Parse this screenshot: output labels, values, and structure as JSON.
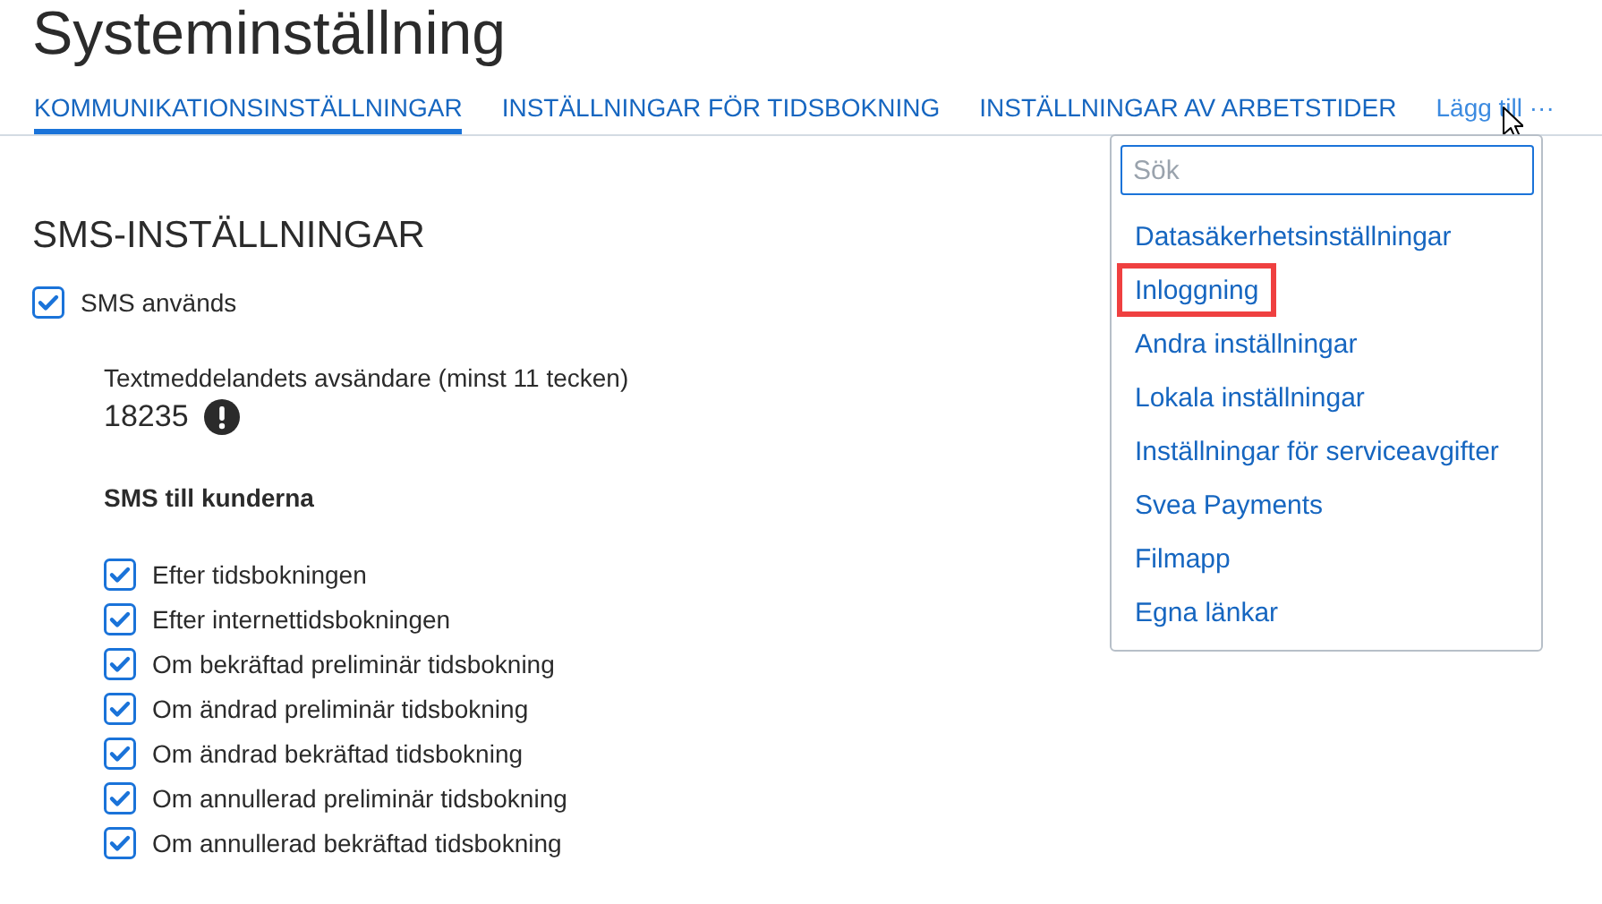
{
  "page": {
    "title": "Systeminställning"
  },
  "tabs": [
    {
      "label": "KOMMUNIKATIONSINSTÄLLNINGAR",
      "selected": true
    },
    {
      "label": "INSTÄLLNINGAR FÖR TIDSBOKNING",
      "selected": false
    },
    {
      "label": "INSTÄLLNINGAR AV ARBETSTIDER",
      "selected": false
    }
  ],
  "add_menu": {
    "label": "Lägg till ···",
    "search": {
      "placeholder": "Sök"
    },
    "items": [
      {
        "label": "Datasäkerhetsinställningar",
        "highlighted": false
      },
      {
        "label": "Inloggning",
        "highlighted": true
      },
      {
        "label": "Andra inställningar",
        "highlighted": false
      },
      {
        "label": "Lokala inställningar",
        "highlighted": false
      },
      {
        "label": "Inställningar för serviceavgifter",
        "highlighted": false
      },
      {
        "label": "Svea Payments",
        "highlighted": false
      },
      {
        "label": "Filmapp",
        "highlighted": false
      },
      {
        "label": "Egna länkar",
        "highlighted": false
      }
    ]
  },
  "sms": {
    "heading": "SMS-INSTÄLLNINGAR",
    "enabled": {
      "label": "SMS används",
      "checked": true
    },
    "sender": {
      "label": "Textmeddelandets avsändare (minst 11 tecken)",
      "value": "18235",
      "warning": true
    },
    "customers_heading": "SMS till kunderna",
    "options": [
      {
        "label": "Efter tidsbokningen",
        "checked": true
      },
      {
        "label": "Efter internettidsbokningen",
        "checked": true
      },
      {
        "label": "Om bekräftad preliminär tidsbokning",
        "checked": true
      },
      {
        "label": "Om ändrad preliminär tidsbokning",
        "checked": true
      },
      {
        "label": "Om ändrad bekräftad tidsbokning",
        "checked": true
      },
      {
        "label": "Om annullerad preliminär tidsbokning",
        "checked": true
      },
      {
        "label": "Om annullerad bekräftad tidsbokning",
        "checked": true
      }
    ]
  }
}
